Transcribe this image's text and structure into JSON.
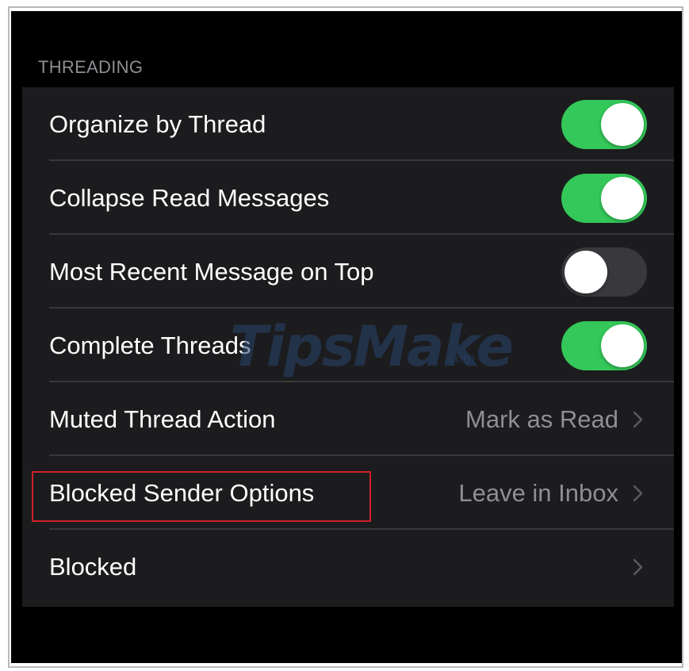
{
  "section": {
    "header": "THREADING"
  },
  "rows": [
    {
      "label": "Organize by Thread",
      "toggle": "on"
    },
    {
      "label": "Collapse Read Messages",
      "toggle": "on"
    },
    {
      "label": "Most Recent Message on Top",
      "toggle": "off"
    },
    {
      "label": "Complete Threads",
      "toggle": "on"
    },
    {
      "label": "Muted Thread Action",
      "value": "Mark as Read"
    },
    {
      "label": "Blocked Sender Options",
      "value": "Leave in Inbox"
    },
    {
      "label": "Blocked"
    }
  ],
  "watermark": {
    "text": "TipsMake",
    "sub": ".com"
  },
  "colors": {
    "background": "#000000",
    "group": "#1c1c1e",
    "toggle_on": "#34c759",
    "toggle_off": "#39393d",
    "secondary_text": "#8e8e93",
    "highlight": "#d0202a"
  }
}
